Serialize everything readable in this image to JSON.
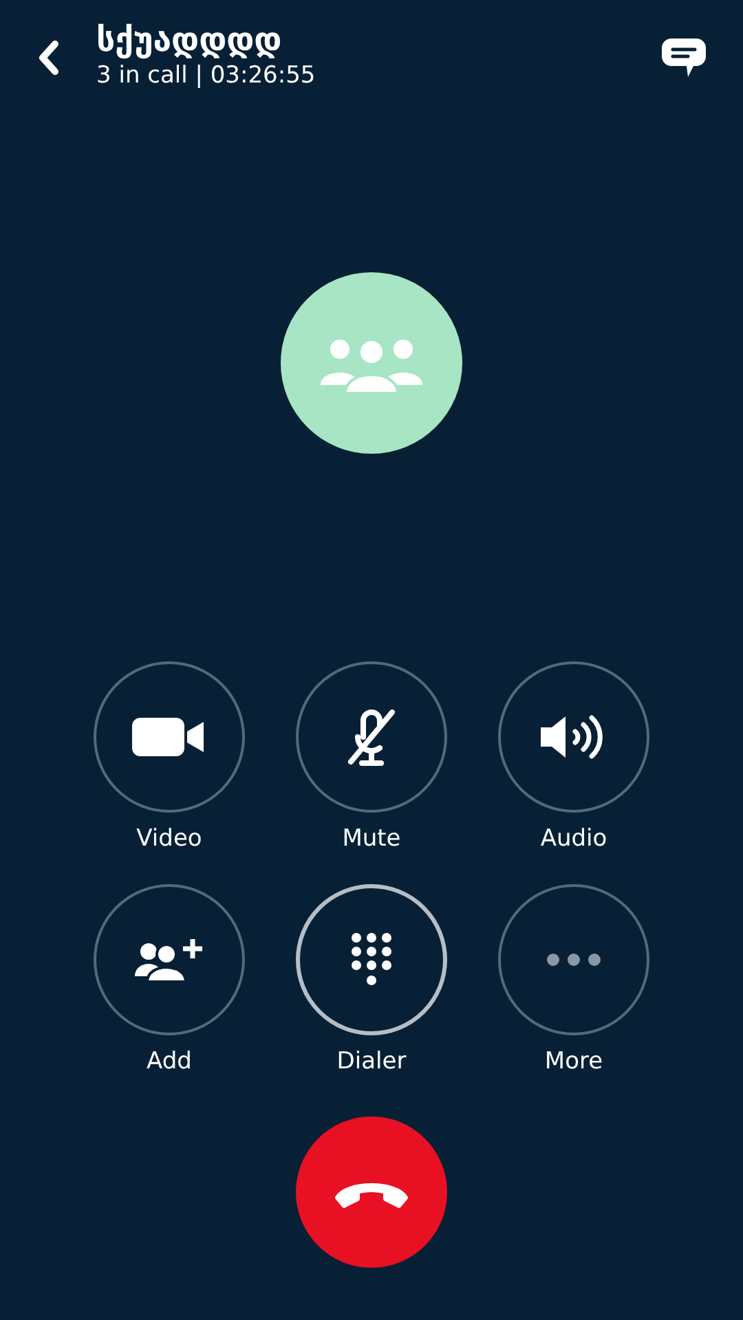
{
  "header": {
    "title": "სქუადდდდ",
    "subtitle": "3 in call | 03:26:55"
  },
  "controls": [
    {
      "kind": "video",
      "label": "Video",
      "highlighted": false,
      "disabled": false
    },
    {
      "kind": "mute",
      "label": "Mute",
      "highlighted": false,
      "disabled": false
    },
    {
      "kind": "audio",
      "label": "Audio",
      "highlighted": false,
      "disabled": false
    },
    {
      "kind": "add",
      "label": "Add",
      "highlighted": false,
      "disabled": false
    },
    {
      "kind": "dialer",
      "label": "Dialer",
      "highlighted": true,
      "disabled": false
    },
    {
      "kind": "more",
      "label": "More",
      "highlighted": false,
      "disabled": true
    }
  ]
}
